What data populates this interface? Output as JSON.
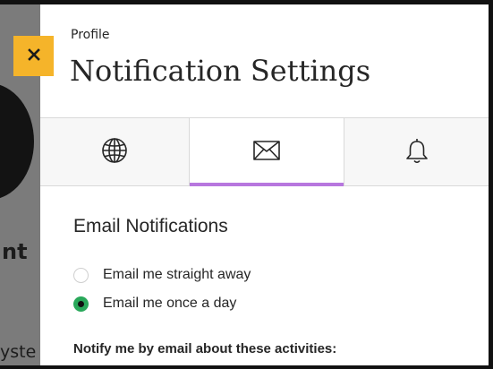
{
  "backdrop": {
    "text_1": "nt",
    "text_2": "yste"
  },
  "close_button": {
    "symbol": "✕",
    "color": "#f5b42a"
  },
  "panel": {
    "breadcrumb": "Profile",
    "title": "Notification Settings"
  },
  "tabs": [
    {
      "icon": "globe-icon",
      "selected": false
    },
    {
      "icon": "envelope-icon",
      "selected": true
    },
    {
      "icon": "bell-icon",
      "selected": false
    }
  ],
  "accent_color": "#b777de",
  "email_section": {
    "title": "Email Notifications",
    "options": [
      {
        "label": "Email me straight away",
        "checked": false
      },
      {
        "label": "Email me once a day",
        "checked": true
      }
    ],
    "activities_heading": "Notify me by email about these activities:"
  },
  "radio_checked_color": "#29a85a"
}
